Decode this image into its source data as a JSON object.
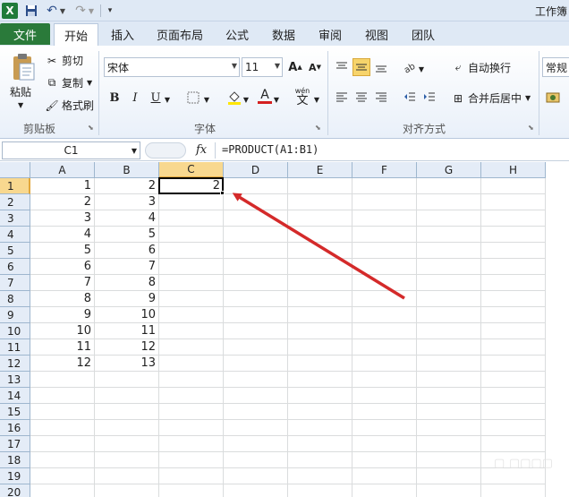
{
  "title_bar": {
    "excel_logo_letter": "X",
    "window_title": "工作簿"
  },
  "tabs": [
    {
      "label": "文件"
    },
    {
      "label": "开始"
    },
    {
      "label": "插入"
    },
    {
      "label": "页面布局"
    },
    {
      "label": "公式"
    },
    {
      "label": "数据"
    },
    {
      "label": "审阅"
    },
    {
      "label": "视图"
    },
    {
      "label": "团队"
    }
  ],
  "ribbon": {
    "clipboard": {
      "paste_label": "粘贴",
      "cut_label": "剪切",
      "copy_label": "复制",
      "format_painter_label": "格式刷",
      "group_label": "剪贴板"
    },
    "font": {
      "font_name": "宋体",
      "font_size": "11",
      "bold": "B",
      "italic": "I",
      "underline": "U",
      "grow": "A",
      "shrink": "A",
      "font_color_letter": "A",
      "phonetic_text": "wén",
      "phonetic_char": "文",
      "group_label": "字体"
    },
    "alignment": {
      "wrap_text_label": "自动换行",
      "merge_center_label": "合并后居中",
      "group_label": "对齐方式"
    },
    "number": {
      "format_label": "常规"
    }
  },
  "formula_bar": {
    "name_box": "C1",
    "fx": "fx",
    "formula": "=PRODUCT(A1:B1)"
  },
  "sheet": {
    "columns": [
      "A",
      "B",
      "C",
      "D",
      "E",
      "F",
      "G",
      "H"
    ],
    "rows": [
      "1",
      "2",
      "3",
      "4",
      "5",
      "6",
      "7",
      "8",
      "9",
      "10",
      "11",
      "12",
      "13",
      "14",
      "15",
      "16",
      "17",
      "18",
      "19",
      "20"
    ],
    "col_a": [
      "1",
      "2",
      "3",
      "4",
      "5",
      "6",
      "7",
      "8",
      "9",
      "10",
      "11",
      "12"
    ],
    "col_b": [
      "2",
      "3",
      "4",
      "5",
      "6",
      "7",
      "8",
      "9",
      "10",
      "11",
      "12",
      "13"
    ],
    "active_cell_value": "2",
    "selected_column": "C",
    "selected_row": "1"
  },
  "annotation": {
    "arrow_color": "#d42a2a"
  },
  "colors": {
    "file_tab": "#2a7a3a",
    "selection_header": "#f8d88f",
    "header_bg": "#e4ecf7"
  }
}
